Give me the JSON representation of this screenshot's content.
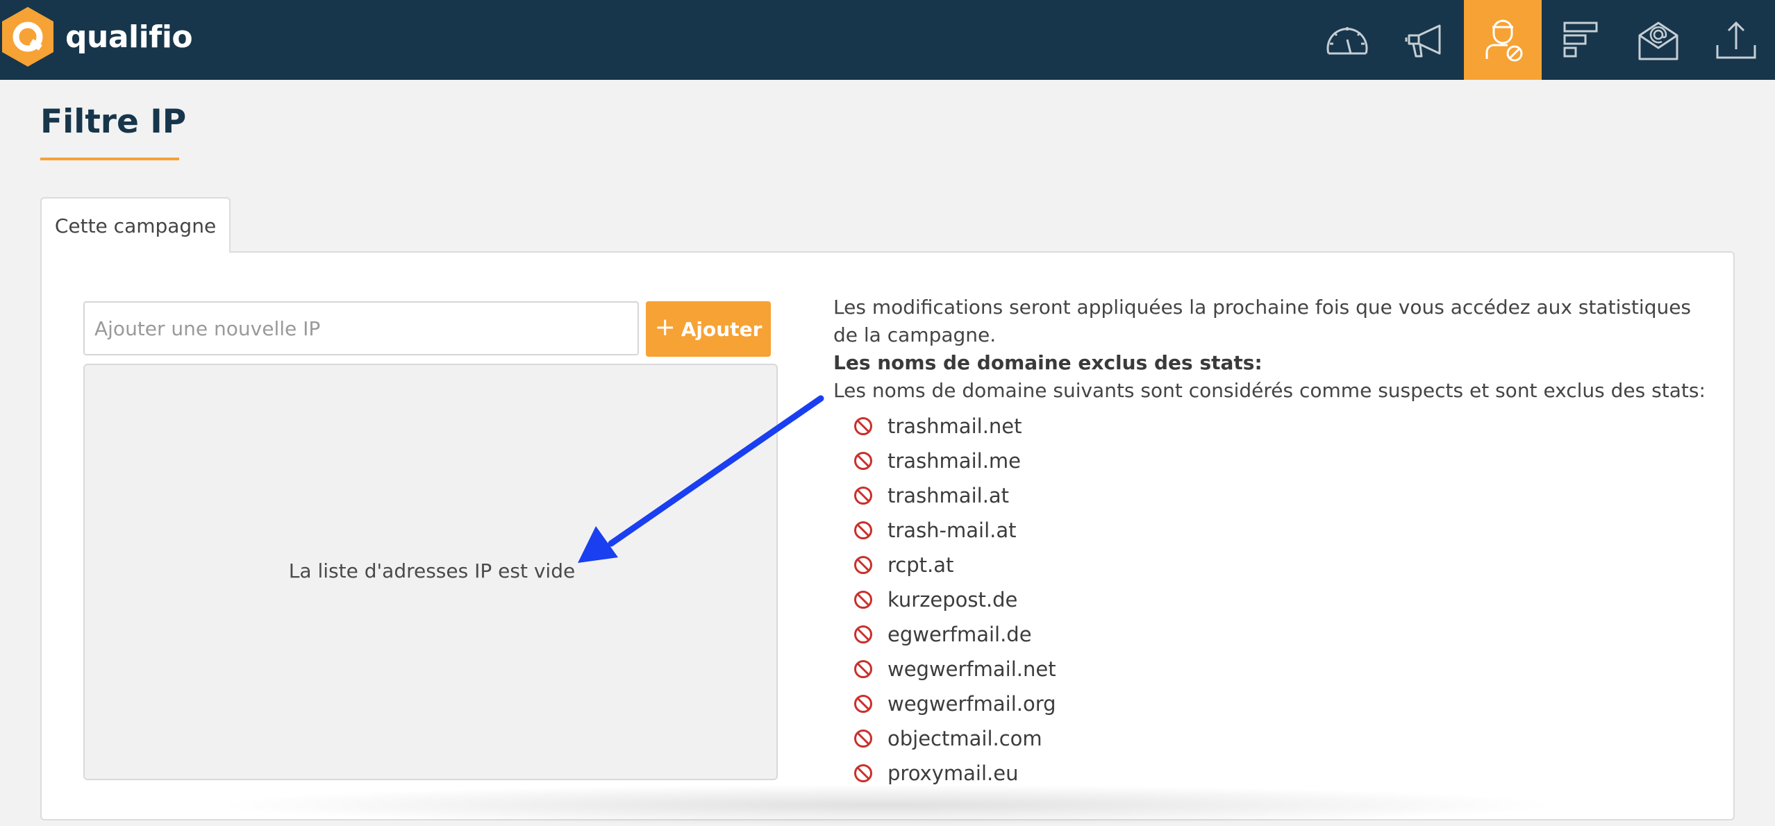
{
  "app": {
    "brand_name": "qualifio",
    "brand_color": "#f7a234",
    "header_color": "#17364b"
  },
  "nav": {
    "items": [
      {
        "icon": "speedometer-icon",
        "active": false
      },
      {
        "icon": "megaphone-icon",
        "active": false
      },
      {
        "icon": "user-blocked-icon",
        "active": true
      },
      {
        "icon": "bar-chart-horizontal-icon",
        "active": false
      },
      {
        "icon": "email-icon",
        "active": false
      },
      {
        "icon": "upload-icon",
        "active": false
      }
    ]
  },
  "page": {
    "title": "Filtre IP"
  },
  "tabs": [
    {
      "label": "Cette campagne",
      "active": true
    }
  ],
  "ip_form": {
    "placeholder": "Ajouter une nouvelle IP",
    "value": "",
    "add_button_label": "Ajouter",
    "empty_message": "La liste d'adresses IP est vide"
  },
  "info": {
    "notice": "Les modifications seront appliquées la prochaine fois que vous accédez aux statistiques de la campagne.",
    "excluded_heading": "Les noms de domaine exclus des stats:",
    "excluded_intro": "Les noms de domaine suivants sont considérés comme suspects et sont exclus des stats:",
    "ban_icon_color": "#c9302c",
    "domains": [
      "trashmail.net",
      "trashmail.me",
      "trashmail.at",
      "trash-mail.at",
      "rcpt.at",
      "kurzepost.de",
      "egwerfmail.de",
      "wegwerfmail.net",
      "wegwerfmail.org",
      "objectmail.com",
      "proxymail.eu"
    ]
  },
  "annotation": {
    "arrow_color": "#1a3ff0"
  }
}
